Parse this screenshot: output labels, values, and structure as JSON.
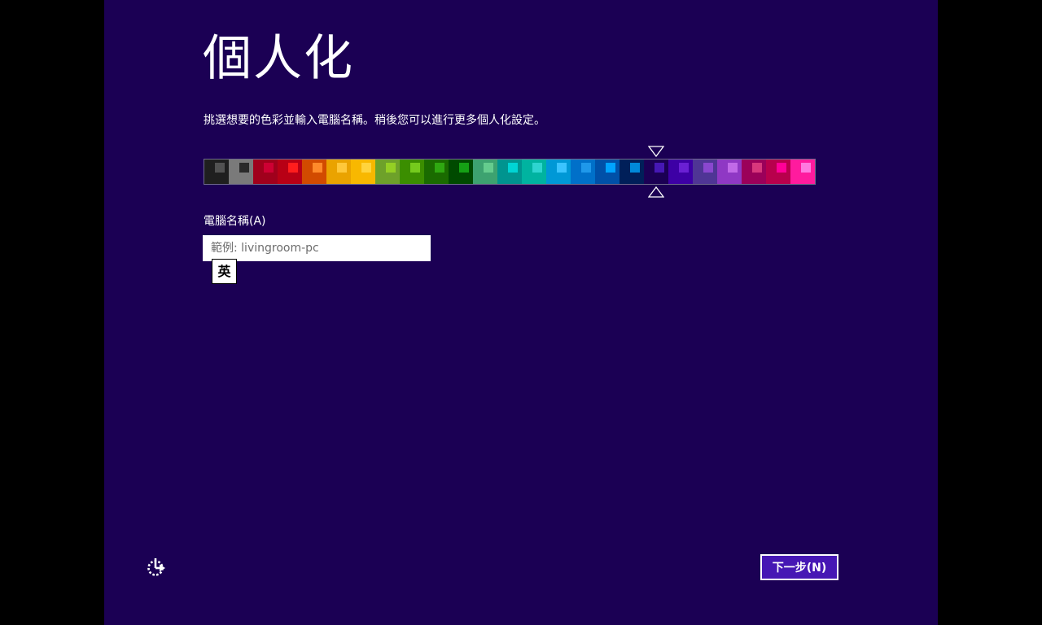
{
  "page": {
    "title": "個人化",
    "instruction": "挑選想要的色彩並輸入電腦名稱。稍後您可以進行更多個人化設定。"
  },
  "palette": {
    "selected_index": 18,
    "swatches": [
      {
        "bg": "#1f1f1f",
        "accent": "#525252"
      },
      {
        "bg": "#7a7a7a",
        "accent": "#2a2a2a"
      },
      {
        "bg": "#a0001c",
        "accent": "#ce0033"
      },
      {
        "bg": "#b80015",
        "accent": "#ff1d1d"
      },
      {
        "bg": "#d24b00",
        "accent": "#ff8a2a"
      },
      {
        "bg": "#eaa300",
        "accent": "#ffc83a"
      },
      {
        "bg": "#f8b800",
        "accent": "#ffd43d"
      },
      {
        "bg": "#6ea12a",
        "accent": "#94cf24"
      },
      {
        "bg": "#3b8e00",
        "accent": "#75cb1d"
      },
      {
        "bg": "#1a6b00",
        "accent": "#2fa811"
      },
      {
        "bg": "#004a00",
        "accent": "#15a115"
      },
      {
        "bg": "#3da270",
        "accent": "#65cc8e"
      },
      {
        "bg": "#00948f",
        "accent": "#00d4d4"
      },
      {
        "bg": "#00b3a0",
        "accent": "#2ed5d0"
      },
      {
        "bg": "#0098d6",
        "accent": "#3bc4ff"
      },
      {
        "bg": "#0070c9",
        "accent": "#1f98ea"
      },
      {
        "bg": "#0050a8",
        "accent": "#00a3ff"
      },
      {
        "bg": "#001f59",
        "accent": "#0089d9"
      },
      {
        "bg": "#1b0054",
        "accent": "#4617b4"
      },
      {
        "bg": "#3d00a5",
        "accent": "#6a20d4"
      },
      {
        "bg": "#4f3595",
        "accent": "#8a47cf"
      },
      {
        "bg": "#8f38c4",
        "accent": "#c16ae8"
      },
      {
        "bg": "#9b005a",
        "accent": "#d9377c"
      },
      {
        "bg": "#b8004c",
        "accent": "#ff0097"
      },
      {
        "bg": "#ff1b9e",
        "accent": "#ff7ae0"
      }
    ]
  },
  "computer_name": {
    "label": "電腦名稱(A)",
    "value": "",
    "placeholder": "範例: livingroom-pc"
  },
  "ime": {
    "mode_label": "英"
  },
  "footer": {
    "accessibility_icon": "ease-of-access-icon",
    "next_label": "下一步(N)"
  },
  "colors": {
    "background": "#1b0054",
    "accent": "#4617b4",
    "text": "#ffffff"
  }
}
